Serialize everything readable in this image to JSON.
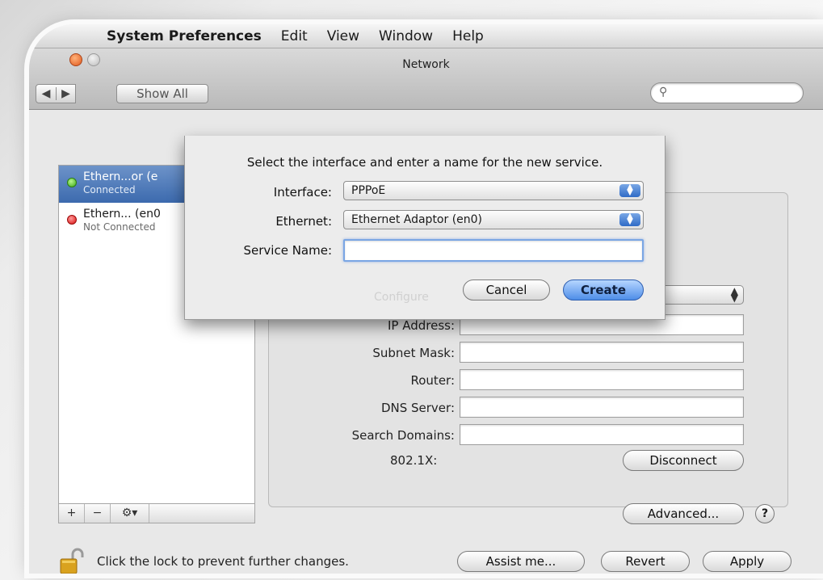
{
  "menubar": {
    "app": "System Preferences",
    "items": [
      "Edit",
      "View",
      "Window",
      "Help"
    ]
  },
  "window": {
    "title": "Network",
    "show_all": "Show All"
  },
  "services": [
    {
      "name": "Ethern...or (e",
      "status": "Connected",
      "status_color": "green",
      "selected": true
    },
    {
      "name": "Ethern... (en0",
      "status": "Not Connected",
      "status_color": "red",
      "selected": false
    }
  ],
  "toolbar": {
    "add": "+",
    "remove": "−",
    "gear": "⚙▾"
  },
  "detail": {
    "fields": [
      {
        "label": "IP Address:",
        "value": ""
      },
      {
        "label": "Subnet Mask:",
        "value": ""
      },
      {
        "label": "Router:",
        "value": ""
      },
      {
        "label": "DNS Server:",
        "value": ""
      },
      {
        "label": "Search Domains:",
        "value": ""
      }
    ],
    "auth_label": "802.1X:",
    "disconnect": "Disconnect",
    "advanced": "Advanced...",
    "help": "?"
  },
  "sheet": {
    "title": "Select the interface and enter a name for the new service.",
    "interface_label": "Interface:",
    "interface_value": "PPPoE",
    "ethernet_label": "Ethernet:",
    "ethernet_value": "Ethernet Adaptor (en0)",
    "service_name_label": "Service Name:",
    "service_name_value": "",
    "configure_ghost": "Configure",
    "cancel": "Cancel",
    "create": "Create"
  },
  "footer": {
    "lock_text": "Click the lock to prevent further changes.",
    "assist": "Assist me...",
    "revert": "Revert",
    "apply": "Apply"
  },
  "colors": {
    "accent": "#4e8de8",
    "selection": "#3c6aae",
    "connected": "#3aa816",
    "not_connected": "#d80e0e"
  }
}
